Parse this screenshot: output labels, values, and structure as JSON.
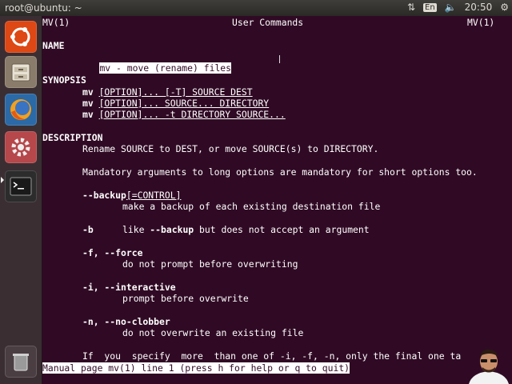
{
  "topbar": {
    "title": "root@ubuntu: ~",
    "lang": "En",
    "time": "20:50"
  },
  "launcher": {
    "items": [
      {
        "name": "dash-home",
        "icon": "ubuntu-logo-icon"
      },
      {
        "name": "files",
        "icon": "file-cabinet-icon"
      },
      {
        "name": "firefox",
        "icon": "firefox-icon"
      },
      {
        "name": "system-settings",
        "icon": "settings-gear-icon"
      },
      {
        "name": "terminal",
        "icon": "terminal-icon"
      },
      {
        "name": "trash",
        "icon": "trash-icon"
      }
    ]
  },
  "man": {
    "header_left": "MV(1)",
    "header_center": "User Commands",
    "header_right": "MV(1)",
    "name_heading": "NAME",
    "name_line": "mv - move (rename) files",
    "synopsis_heading": "SYNOPSIS",
    "synopsis": [
      {
        "cmd": "mv",
        "rest": "[OPTION]... [-T] SOURCE DEST"
      },
      {
        "cmd": "mv",
        "rest": "[OPTION]... SOURCE... DIRECTORY"
      },
      {
        "cmd": "mv",
        "rest": "[OPTION]... -t DIRECTORY SOURCE..."
      }
    ],
    "description_heading": "DESCRIPTION",
    "desc1": "Rename SOURCE to DEST, or move SOURCE(s) to DIRECTORY.",
    "desc2": "Mandatory arguments to long options are mandatory for short options too.",
    "backup_opt": "--backup",
    "backup_arg": "[=CONTROL]",
    "backup_desc": "make a backup of each existing destination file",
    "b_opt": "-b",
    "b_desc_pre": "like ",
    "b_desc_bold": "--backup",
    "b_desc_post": " but does not accept an argument",
    "f_opt": "-f, --force",
    "f_desc": "do not prompt before overwriting",
    "i_opt": "-i, --interactive",
    "i_desc": "prompt before overwrite",
    "n_opt": "-n, --no-clobber",
    "n_desc": "do not overwrite an existing file",
    "last_line": "If  you  specify  more  than one of -i, -f, -n, only the final one ta",
    "status": "Manual page mv(1) line 1 (press h for help or q to quit)"
  }
}
